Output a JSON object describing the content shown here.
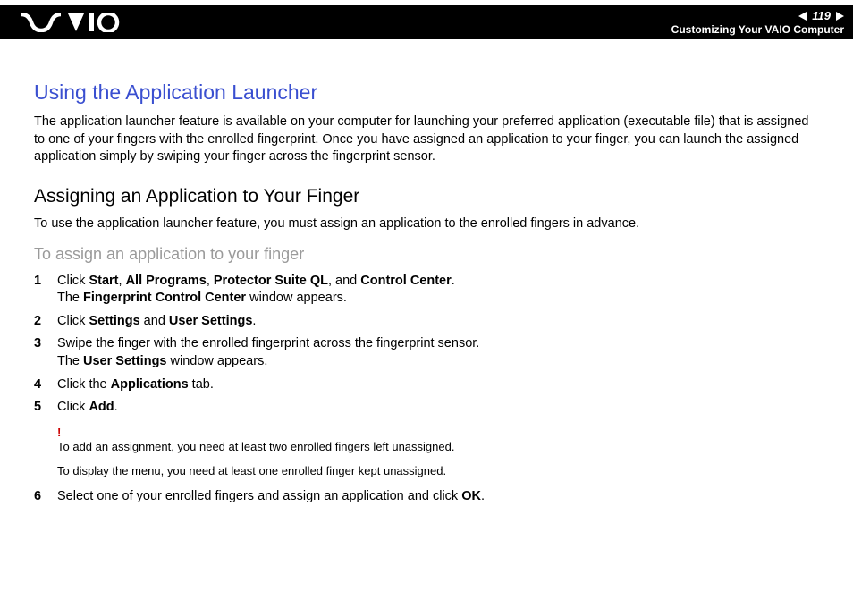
{
  "header": {
    "page_number": "119",
    "section": "Customizing Your VAIO Computer"
  },
  "h1": "Using the Application Launcher",
  "intro": "The application launcher feature is available on your computer for launching your preferred application (executable file) that is assigned to one of your fingers with the enrolled fingerprint. Once you have assigned an application to your finger, you can launch the assigned application simply by swiping your finger across the fingerprint sensor.",
  "h2": "Assigning an Application to Your Finger",
  "para2": "To use the application launcher feature, you must assign an application to the enrolled fingers in advance.",
  "h3": "To assign an application to your finger",
  "steps": {
    "s1_num": "1",
    "s1_a": "Click ",
    "s1_b1": "Start",
    "s1_c": ", ",
    "s1_b2": "All Programs",
    "s1_d": ", ",
    "s1_b3": "Protector Suite QL",
    "s1_e": ", and ",
    "s1_b4": "Control Center",
    "s1_f": ".",
    "s1_g": "The ",
    "s1_b5": "Fingerprint Control Center",
    "s1_h": " window appears.",
    "s2_num": "2",
    "s2_a": "Click ",
    "s2_b1": "Settings",
    "s2_c": " and ",
    "s2_b2": "User Settings",
    "s2_d": ".",
    "s3_num": "3",
    "s3_a": "Swipe the finger with the enrolled fingerprint across the fingerprint sensor.",
    "s3_b": "The ",
    "s3_b1": "User Settings",
    "s3_c": " window appears.",
    "s4_num": "4",
    "s4_a": "Click the ",
    "s4_b1": "Applications",
    "s4_c": " tab.",
    "s5_num": "5",
    "s5_a": "Click ",
    "s5_b1": "Add",
    "s5_c": ".",
    "s6_num": "6",
    "s6_a": "Select one of your enrolled fingers and assign an application and click ",
    "s6_b1": "OK",
    "s6_c": "."
  },
  "notes": {
    "excl": "!",
    "n1": "To add an assignment, you need at least two enrolled fingers left unassigned.",
    "n2": "To display the menu, you need at least one enrolled finger kept unassigned."
  }
}
